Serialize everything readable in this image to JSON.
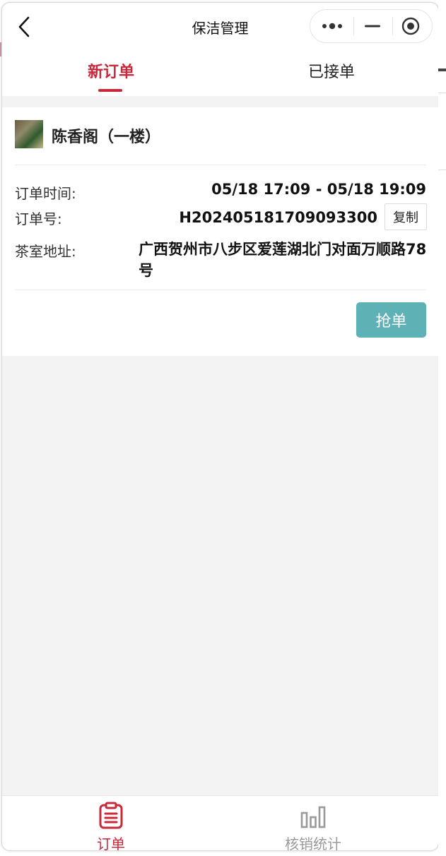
{
  "nav": {
    "title": "保洁管理",
    "back_icon": "chevron-left-icon",
    "more_icon": "more-dots-icon",
    "minimize_icon": "minimize-icon",
    "close_icon": "target-close-icon"
  },
  "tabs": [
    {
      "label": "新订单",
      "active": true
    },
    {
      "label": "已接单",
      "active": false
    }
  ],
  "order": {
    "shop_name": "陈香阁（一楼）",
    "time_label": "订单时间:",
    "time_value": "05/18 17:09 - 05/18 19:09",
    "number_label": "订单号:",
    "number_value": "H202405181709093300",
    "copy_label": "复制",
    "address_label": "茶室地址:",
    "address_value": "广西贺州市八步区爱莲湖北门对面万顺路78号",
    "grab_label": "抢单"
  },
  "tabbar": [
    {
      "label": "订单",
      "icon": "clipboard-list-icon",
      "active": true
    },
    {
      "label": "核销统计",
      "icon": "bar-chart-icon",
      "active": false
    }
  ],
  "colors": {
    "accent": "#c8283a",
    "grab_button": "#5eb1b4",
    "inactive": "#999999"
  }
}
